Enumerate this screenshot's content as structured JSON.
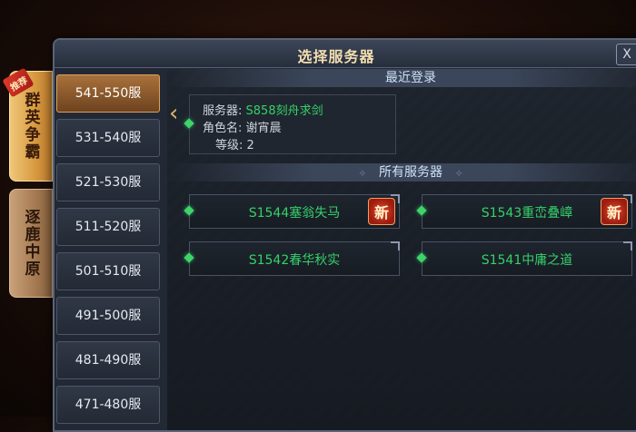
{
  "side_tabs": {
    "recommend_badge": "推荐",
    "qunying": "群英争霸",
    "zhulu": "逐鹿中原"
  },
  "window": {
    "title": "选择服务器",
    "close_label": "X"
  },
  "ranges": [
    "541-550服",
    "531-540服",
    "521-530服",
    "511-520服",
    "501-510服",
    "491-500服",
    "481-490服",
    "471-480服"
  ],
  "recent": {
    "header": "最近登录",
    "server_label": "服务器:",
    "server_value": "S858刻舟求剑",
    "role_label": "角色名:",
    "role_value": "谢宵晨",
    "level_label": "等级:",
    "level_value": "2"
  },
  "all_servers": {
    "header": "所有服务器",
    "items": [
      {
        "name": "S1544塞翁失马",
        "badge": "新"
      },
      {
        "name": "S1543重峦叠嶂",
        "badge": "新"
      },
      {
        "name": "S1542春华秋实",
        "badge": ""
      },
      {
        "name": "S1541中庸之道",
        "badge": ""
      }
    ]
  },
  "colors": {
    "accent_green": "#35d16a",
    "gold": "#f3deb0",
    "active_tab": "#a9713a"
  }
}
